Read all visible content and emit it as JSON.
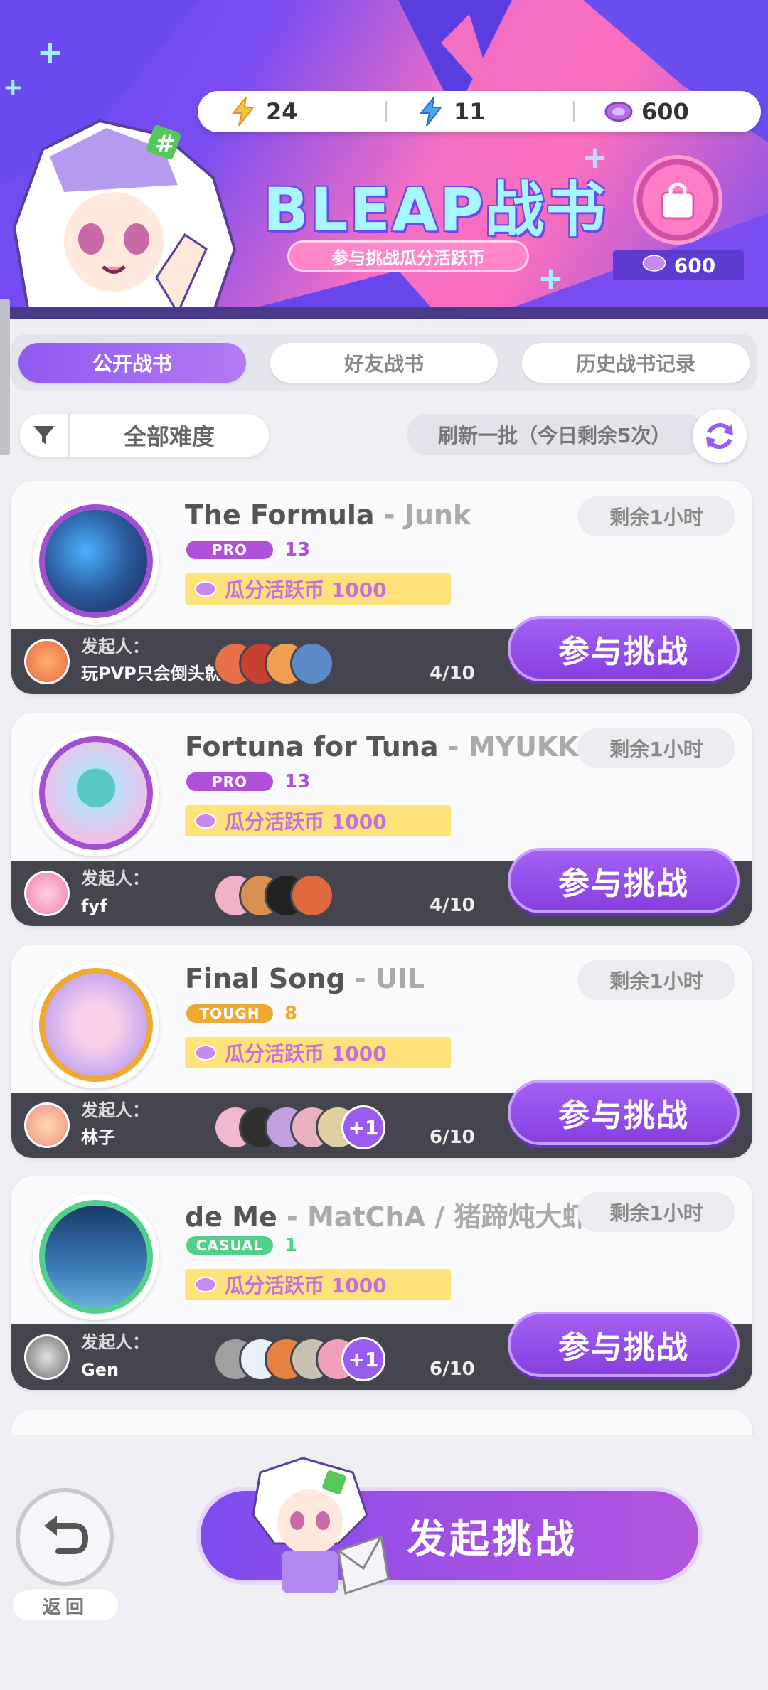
{
  "header": {
    "title": "BLEAP战书",
    "subtitle": "参与挑战瓜分活跃币",
    "currencies": [
      {
        "icon": "lightning-yellow-icon",
        "value": "24"
      },
      {
        "icon": "lightning-blue-icon",
        "value": "11"
      },
      {
        "icon": "coin-icon",
        "value": "600"
      }
    ],
    "shop_coin": "600"
  },
  "tabs": [
    {
      "label": "公开战书",
      "active": true
    },
    {
      "label": "好友战书",
      "active": false
    },
    {
      "label": "历史战书记录",
      "active": false
    }
  ],
  "filter": {
    "label": "全部难度"
  },
  "refresh": {
    "label": "刷新一批（今日剩余5次）"
  },
  "cards": [
    {
      "song": "The Formula",
      "artist": " - Junk",
      "difficulty": "PRO",
      "level": "13",
      "reward": "瓜分活跃币 1000",
      "time_left": "剩余1小时",
      "host_label": "发起人：",
      "host_name": "玩PVP只会倒头就睡",
      "count": "4/10",
      "join_label": "参与挑战"
    },
    {
      "song": "Fortuna for Tuna",
      "artist": " - MYUKKE",
      "difficulty": "PRO",
      "level": "13",
      "reward": "瓜分活跃币 1000",
      "time_left": "剩余1小时",
      "host_label": "发起人：",
      "host_name": "fyf",
      "count": "4/10",
      "join_label": "参与挑战"
    },
    {
      "song": "Final Song",
      "artist": " - UIL",
      "difficulty": "TOUGH",
      "level": "8",
      "reward": "瓜分活跃币 1000",
      "time_left": "剩余1小时",
      "host_label": "发起人：",
      "host_name": "林子",
      "count": "6/10",
      "more": "+1",
      "join_label": "参与挑战"
    },
    {
      "song": "de Me",
      "artist": " - MatChA / 猪蹄炖大虾",
      "difficulty": "CASUAL",
      "level": "1",
      "reward": "瓜分活跃币 1000",
      "time_left": "剩余1小时",
      "host_label": "发起人：",
      "host_name": "Gen",
      "count": "6/10",
      "more": "+1",
      "join_label": "参与挑战"
    }
  ],
  "bottom": {
    "back_label": "返回",
    "start_label": "发起挑战"
  },
  "colors": {
    "accent": "#9a5cf0",
    "pro": "#b050d8",
    "tough": "#f0a830",
    "casual": "#52d08a"
  }
}
